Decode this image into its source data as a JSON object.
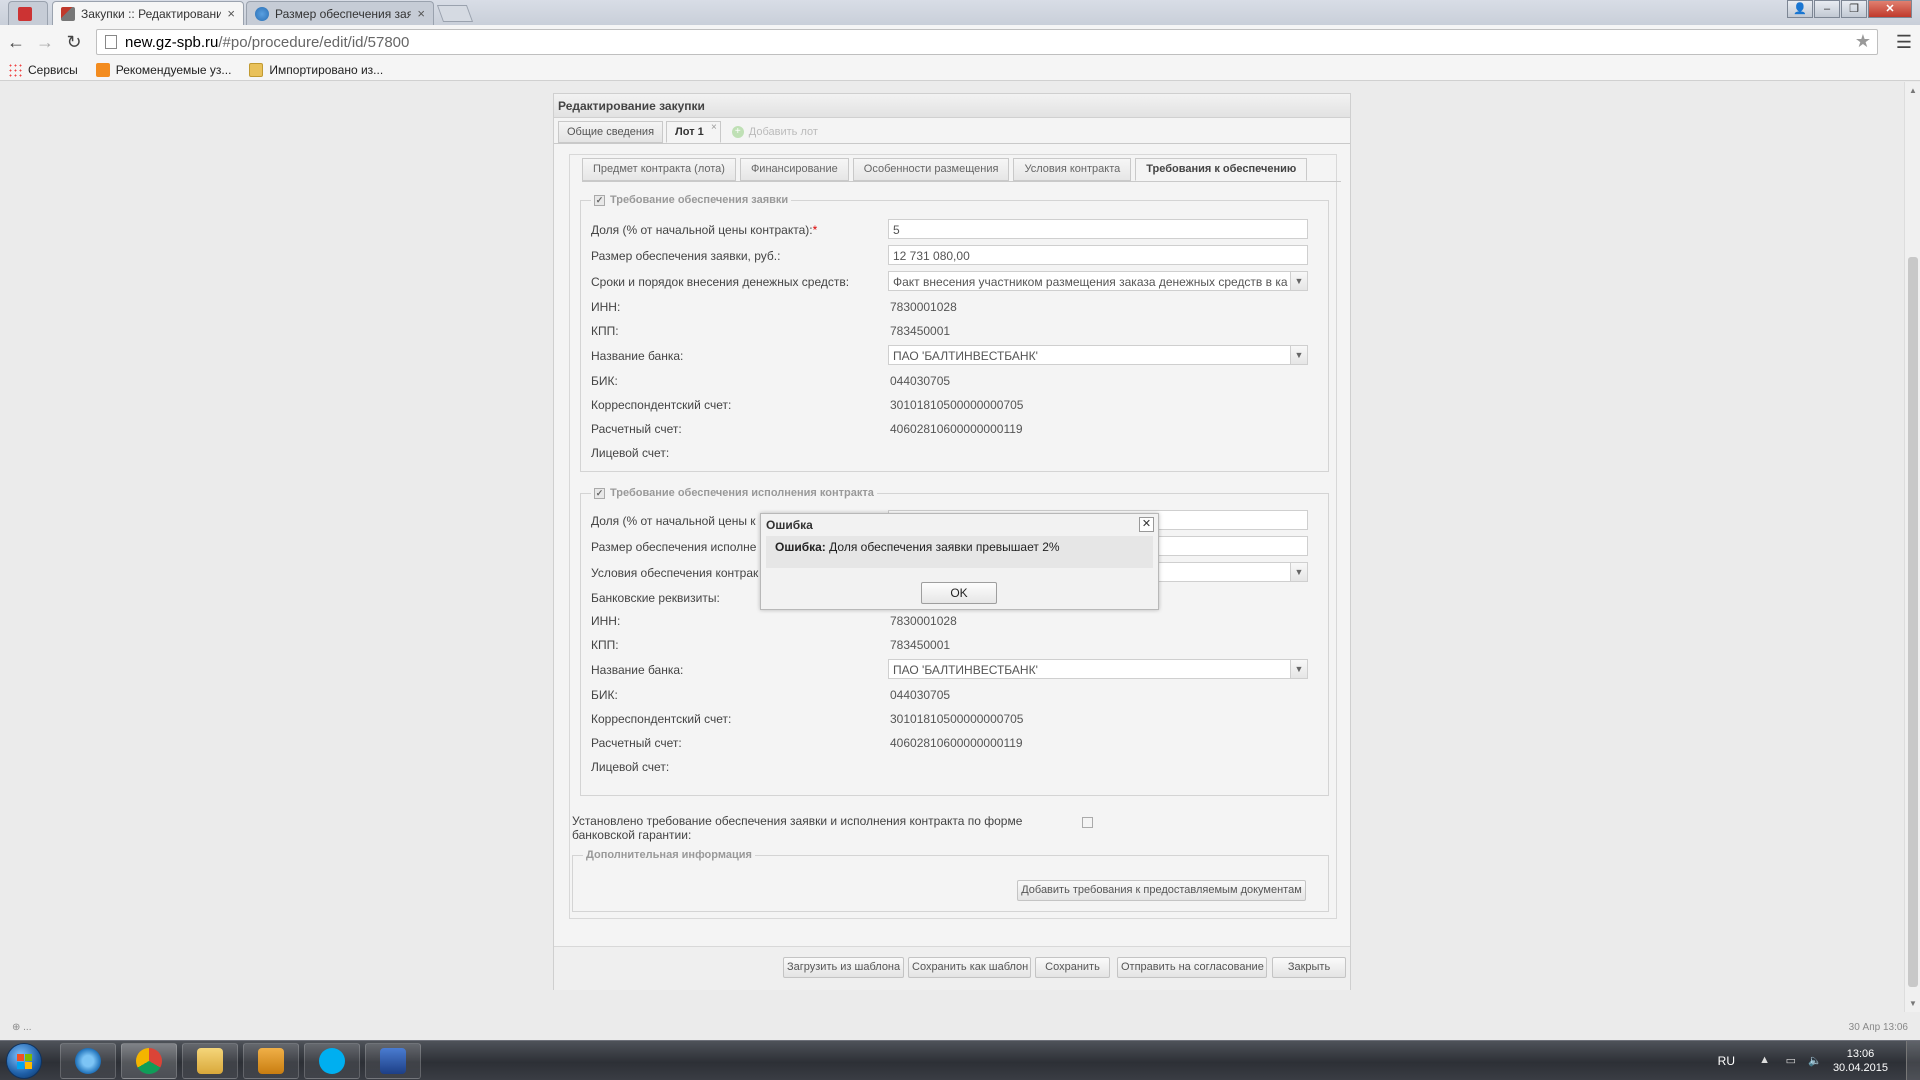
{
  "browser": {
    "tabs": [
      {
        "title": "Закупки :: Редактирование закупки",
        "favicon": "tools-icon"
      },
      {
        "title": "Размер обеспечения заявки",
        "favicon": "globe-icon"
      }
    ],
    "url_domain": "new.gz-spb.ru",
    "url_path": "/#po/procedure/edit/id/57800",
    "bookmarks": [
      "Сервисы",
      "Рекомендуемые уз...",
      "Импортировано из..."
    ]
  },
  "page": {
    "title": "Редактирование закупки",
    "top_tabs": [
      {
        "label": "Общие сведения"
      },
      {
        "label": "Лот 1",
        "close": "×"
      },
      {
        "label": "Добавить лот"
      }
    ],
    "sub_tabs": [
      "Предмет контракта (лота)",
      "Финансирование",
      "Особенности размещения",
      "Условия контракта",
      "Требования к обеспечению"
    ],
    "bid_security": {
      "legend": "Требование обеспечения заявки",
      "share_label": "Доля (% от начальной цены контракта):",
      "share_value": "5",
      "amount_label": "Размер обеспечения заявки, руб.:",
      "amount_value": "12 731 080,00",
      "terms_label": "Сроки и порядок внесения денежных средств:",
      "terms_value": "Факт внесения участником размещения заказа денежных средств в ка",
      "inn_label": "ИНН:",
      "inn_value": "7830001028",
      "kpp_label": "КПП:",
      "kpp_value": "783450001",
      "bank_label": "Название банка:",
      "bank_value": "ПАО 'БАЛТИНВЕСТБАНК'",
      "bik_label": "БИК:",
      "bik_value": "044030705",
      "corr_label": "Корреспондентский счет:",
      "corr_value": "30101810500000000705",
      "acc_label": "Расчетный счет:",
      "acc_value": "40602810600000000119",
      "personal_label": "Лицевой счет:"
    },
    "contract_security": {
      "legend": "Требование обеспечения исполнения контракта",
      "share_label": "Доля (% от начальной цены к",
      "size_label": "Размер обеспечения исполне",
      "cond_label": "Условия обеспечения контрак",
      "bank_details_label": "Банковские реквизиты:",
      "inn_label": "ИНН:",
      "inn_value": "7830001028",
      "kpp_label": "КПП:",
      "kpp_value": "783450001",
      "bank_label": "Название банка:",
      "bank_value": "ПАО 'БАЛТИНВЕСТБАНК'",
      "bik_label": "БИК:",
      "bik_value": "044030705",
      "corr_label": "Корреспондентский счет:",
      "corr_value": "30101810500000000705",
      "acc_label": "Расчетный счет:",
      "acc_value": "40602810600000000119",
      "personal_label": "Лицевой счет:"
    },
    "guarantee_label_1": "Установлено требование обеспечения заявки и исполнения контракта по форме",
    "guarantee_label_2": "банковской гарантии:",
    "additional_legend": "Дополнительная информация",
    "add_requirements_btn": "Добавить требования к предоставляемым документам",
    "footer_buttons": [
      "Загрузить из шаблона",
      "Сохранить как шаблон",
      "Сохранить",
      "Отправить на согласование",
      "Закрыть"
    ]
  },
  "modal": {
    "title": "Ошибка",
    "message_bold": "Ошибка:",
    "message": " Доля обеспечения заявки превышает 2%",
    "ok": "OK"
  },
  "status": {
    "left": "⊕ ...",
    "right": "30 Апр 13:06"
  },
  "taskbar": {
    "lang": "RU",
    "time": "13:06",
    "date": "30.04.2015"
  }
}
